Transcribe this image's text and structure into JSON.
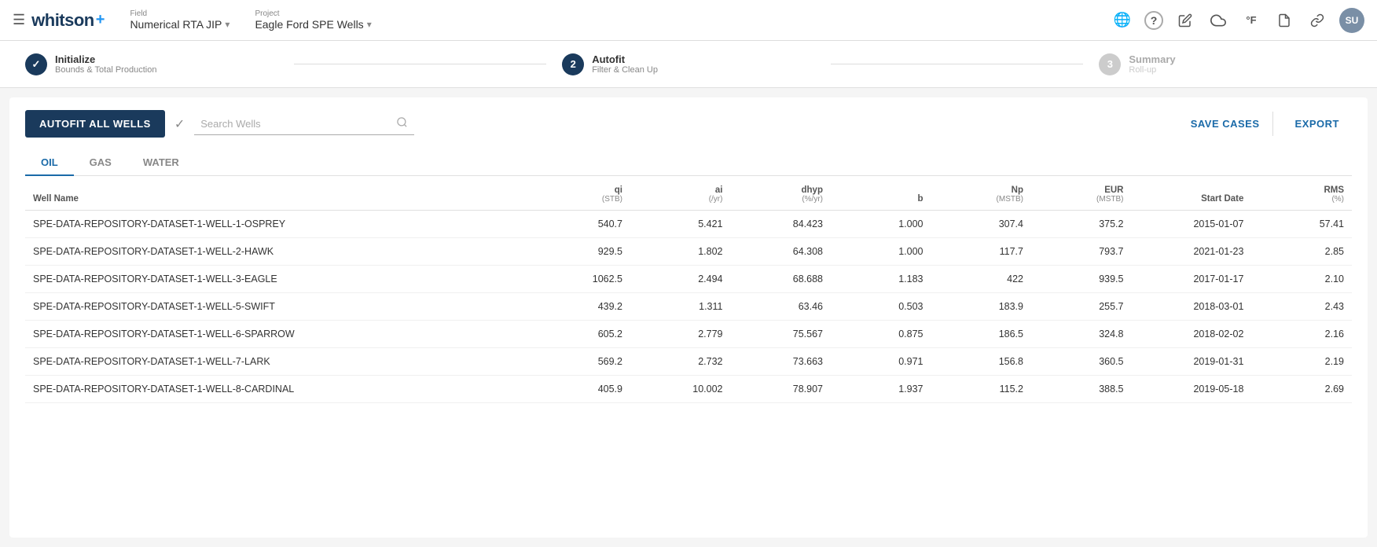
{
  "navbar": {
    "hamburger_icon": "☰",
    "logo_text": "whitson",
    "logo_plus": "+",
    "field_label": "Field",
    "field_value": "Numerical RTA JIP",
    "project_label": "Project",
    "project_value": "Eagle Ford SPE Wells",
    "icons": [
      "🌐",
      "?",
      "✏",
      "☁",
      "°F",
      "📄",
      "🔗"
    ],
    "avatar": "SU"
  },
  "stepper": {
    "steps": [
      {
        "number": "✓",
        "title": "Initialize",
        "subtitle": "Bounds & Total Production",
        "state": "done"
      },
      {
        "number": "2",
        "title": "Autofit",
        "subtitle": "Filter & Clean Up",
        "state": "active"
      },
      {
        "number": "3",
        "title": "Summary",
        "subtitle": "Roll-up",
        "state": "inactive"
      }
    ]
  },
  "toolbar": {
    "autofit_label": "AUTOFIT ALL WELLS",
    "search_placeholder": "Search Wells",
    "save_cases_label": "SAVE CASES",
    "export_label": "EXPORT"
  },
  "tabs": [
    "OIL",
    "GAS",
    "WATER"
  ],
  "active_tab": "OIL",
  "table": {
    "columns": [
      {
        "main": "Well Name",
        "sub": ""
      },
      {
        "main": "qi",
        "sub": "(STB)"
      },
      {
        "main": "ai",
        "sub": "(/yr)"
      },
      {
        "main": "dhyp",
        "sub": "(%/yr)"
      },
      {
        "main": "b",
        "sub": ""
      },
      {
        "main": "Np",
        "sub": "(MSTB)"
      },
      {
        "main": "EUR",
        "sub": "(MSTB)"
      },
      {
        "main": "Start Date",
        "sub": ""
      },
      {
        "main": "RMS",
        "sub": "(%)"
      }
    ],
    "rows": [
      {
        "name": "SPE-DATA-REPOSITORY-DATASET-1-WELL-1-OSPREY",
        "qi": "540.7",
        "ai": "5.421",
        "dhyp": "84.423",
        "b": "1.000",
        "np": "307.4",
        "eur": "375.2",
        "start_date": "2015-01-07",
        "rms": "57.41"
      },
      {
        "name": "SPE-DATA-REPOSITORY-DATASET-1-WELL-2-HAWK",
        "qi": "929.5",
        "ai": "1.802",
        "dhyp": "64.308",
        "b": "1.000",
        "np": "117.7",
        "eur": "793.7",
        "start_date": "2021-01-23",
        "rms": "2.85"
      },
      {
        "name": "SPE-DATA-REPOSITORY-DATASET-1-WELL-3-EAGLE",
        "qi": "1062.5",
        "ai": "2.494",
        "dhyp": "68.688",
        "b": "1.183",
        "np": "422",
        "eur": "939.5",
        "start_date": "2017-01-17",
        "rms": "2.10"
      },
      {
        "name": "SPE-DATA-REPOSITORY-DATASET-1-WELL-5-SWIFT",
        "qi": "439.2",
        "ai": "1.311",
        "dhyp": "63.46",
        "b": "0.503",
        "np": "183.9",
        "eur": "255.7",
        "start_date": "2018-03-01",
        "rms": "2.43"
      },
      {
        "name": "SPE-DATA-REPOSITORY-DATASET-1-WELL-6-SPARROW",
        "qi": "605.2",
        "ai": "2.779",
        "dhyp": "75.567",
        "b": "0.875",
        "np": "186.5",
        "eur": "324.8",
        "start_date": "2018-02-02",
        "rms": "2.16"
      },
      {
        "name": "SPE-DATA-REPOSITORY-DATASET-1-WELL-7-LARK",
        "qi": "569.2",
        "ai": "2.732",
        "dhyp": "73.663",
        "b": "0.971",
        "np": "156.8",
        "eur": "360.5",
        "start_date": "2019-01-31",
        "rms": "2.19"
      },
      {
        "name": "SPE-DATA-REPOSITORY-DATASET-1-WELL-8-CARDINAL",
        "qi": "405.9",
        "ai": "10.002",
        "dhyp": "78.907",
        "b": "1.937",
        "np": "115.2",
        "eur": "388.5",
        "start_date": "2019-05-18",
        "rms": "2.69"
      }
    ]
  }
}
